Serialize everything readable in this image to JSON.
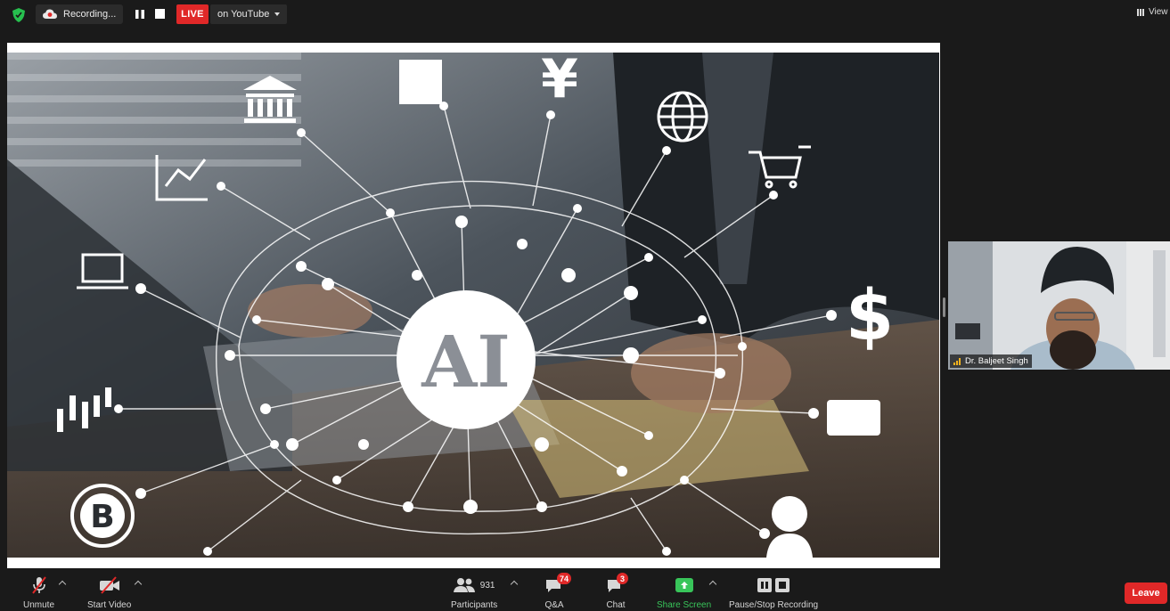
{
  "top_bar": {
    "recording_label": "Recording...",
    "live_label": "LIVE",
    "stream_target": "on YouTube",
    "view_label": "View"
  },
  "shared_screen": {
    "center_text": "AI"
  },
  "participant": {
    "name": "Dr. Baljeet Singh"
  },
  "toolbar": {
    "unmute": "Unmute",
    "start_video": "Start Video",
    "participants": "Participants",
    "participant_count": "931",
    "qa": "Q&A",
    "qa_badge": "74",
    "chat": "Chat",
    "chat_badge": "3",
    "share_screen": "Share Screen",
    "pause_stop_recording": "Pause/Stop Recording",
    "leave": "Leave"
  },
  "colors": {
    "live_red": "#e02828",
    "share_green": "#38c55a",
    "toolbar_bg": "#1a1a1a"
  },
  "icons": [
    "shield-icon",
    "cloud-record-icon",
    "pause-icon",
    "stop-icon",
    "grid-view-icon",
    "mic-muted-icon",
    "video-off-icon",
    "participants-icon",
    "qa-icon",
    "chat-icon",
    "share-screen-icon",
    "pause-stop-recording-icon"
  ]
}
